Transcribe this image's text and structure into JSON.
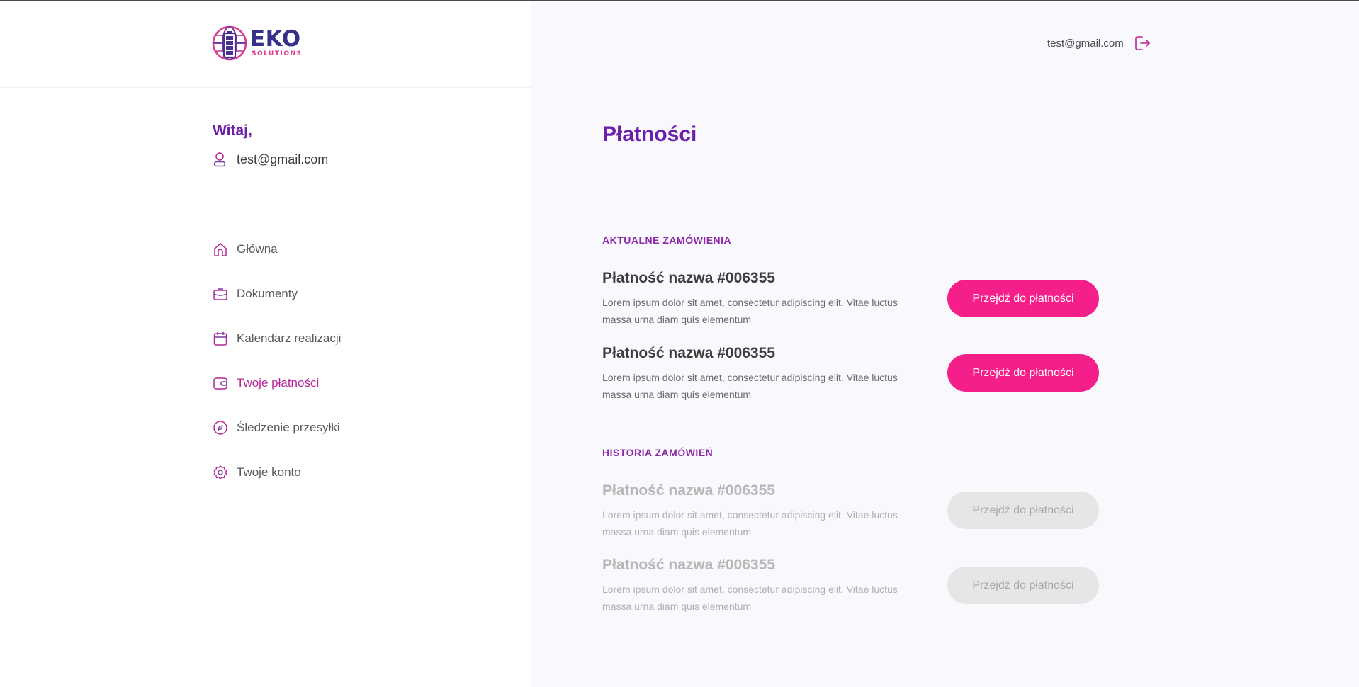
{
  "brand": {
    "name": "EKO",
    "tagline": "SOLUTIONS",
    "colors": {
      "primary": "#6b1faa",
      "accent": "#f51f8a",
      "logo_blue": "#34308c",
      "logo_pink": "#e23a8c"
    }
  },
  "header": {
    "user_email": "test@gmail.com",
    "logout_icon": "logout-icon"
  },
  "sidebar": {
    "greeting": "Witaj,",
    "user_email": "test@gmail.com",
    "user_icon": "user-icon",
    "items": [
      {
        "label": "Główna",
        "icon": "home-icon",
        "active": false
      },
      {
        "label": "Dokumenty",
        "icon": "briefcase-icon",
        "active": false
      },
      {
        "label": "Kalendarz realizacji",
        "icon": "calendar-icon",
        "active": false
      },
      {
        "label": "Twoje płatności",
        "icon": "wallet-icon",
        "active": true
      },
      {
        "label": "Śledzenie przesyłki",
        "icon": "compass-icon",
        "active": false
      },
      {
        "label": "Twoje konto",
        "icon": "settings-icon",
        "active": false
      }
    ]
  },
  "main": {
    "title": "Płatności",
    "current": {
      "title": "AKTUALNE ZAMÓWIENIA",
      "items": [
        {
          "name": "Płatność nazwa #006355",
          "description": "Lorem ipsum dolor sit amet, consectetur adipiscing elit. Vitae luctus massa urna diam quis elementum",
          "button": "Przejdź do płatności"
        },
        {
          "name": "Płatność nazwa #006355",
          "description": "Lorem ipsum dolor sit amet, consectetur adipiscing elit. Vitae luctus massa urna diam quis elementum",
          "button": "Przejdź do płatności"
        }
      ]
    },
    "history": {
      "title": "HISTORIA ZAMÓWIEŃ",
      "items": [
        {
          "name": "Płatność nazwa #006355",
          "description": "Lorem ipsum dolor sit amet, consectetur adipiscing elit. Vitae luctus massa urna diam quis elementum",
          "button": "Przejdź do płatności"
        },
        {
          "name": "Płatność nazwa #006355",
          "description": "Lorem ipsum dolor sit amet, consectetur adipiscing elit. Vitae luctus massa urna diam quis elementum",
          "button": "Przejdź do płatności"
        }
      ]
    }
  }
}
